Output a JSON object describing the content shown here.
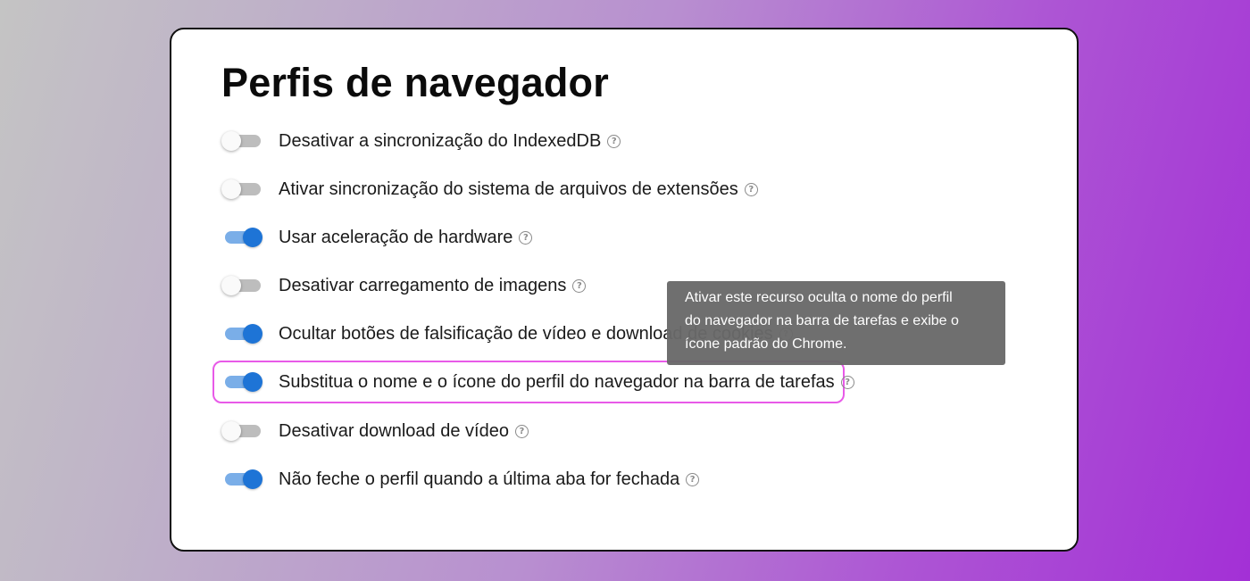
{
  "page_title": "Perfis de navegador",
  "settings": [
    {
      "label": "Desativar a sincronização do IndexedDB",
      "enabled": false
    },
    {
      "label": "Ativar sincronização do sistema de arquivos de extensões",
      "enabled": false
    },
    {
      "label": "Usar aceleração de hardware",
      "enabled": true
    },
    {
      "label": "Desativar carregamento de imagens",
      "enabled": false
    },
    {
      "label": "Ocultar botões de falsificação de vídeo e download de cookies",
      "enabled": true
    },
    {
      "label": "Substitua o nome e o ícone do perfil do navegador na barra de tarefas",
      "enabled": true
    },
    {
      "label": "Desativar download de vídeo",
      "enabled": false
    },
    {
      "label": "Não feche o perfil quando a última aba for fechada",
      "enabled": true
    }
  ],
  "help_glyph": "?",
  "tooltip": {
    "lines": [
      "Ativar este recurso oculta o nome do perfil",
      "do navegador na barra de tarefas e exibe o",
      "ícone padrão do Chrome."
    ]
  },
  "colors": {
    "toggle_on_knob": "#1e74d6",
    "toggle_on_track": "#7aaee8",
    "toggle_off_track": "#bdbdbd",
    "highlight_border": "#e85ae8",
    "tooltip_bg": "#696969"
  },
  "icons": {
    "help": "question-circle-icon"
  }
}
